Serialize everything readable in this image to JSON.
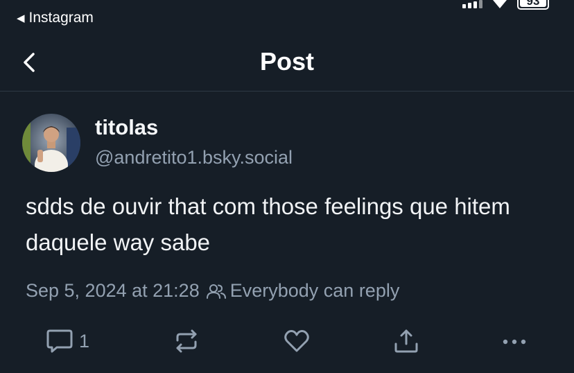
{
  "status_bar": {
    "back_app_label": "Instagram",
    "battery_level": "93"
  },
  "nav": {
    "title": "Post"
  },
  "post": {
    "author_display_name": "titolas",
    "author_handle": "@andretito1.bsky.social",
    "text": "sdds de ouvir that com those feelings que hitem daquele way sabe",
    "timestamp": "Sep 5, 2024 at 21:28",
    "reply_setting": "Everybody can reply",
    "reply_count": "1"
  },
  "icons": {
    "back": "chevron-left-icon",
    "reply": "speech-bubble-icon",
    "repost": "repost-icon",
    "like": "heart-icon",
    "share": "share-icon",
    "more": "more-horizontal-icon",
    "audience": "people-icon"
  },
  "colors": {
    "background": "#161e27",
    "text_primary": "#f1f3f5",
    "text_secondary": "#93a1b1",
    "divider": "#2e3945"
  }
}
